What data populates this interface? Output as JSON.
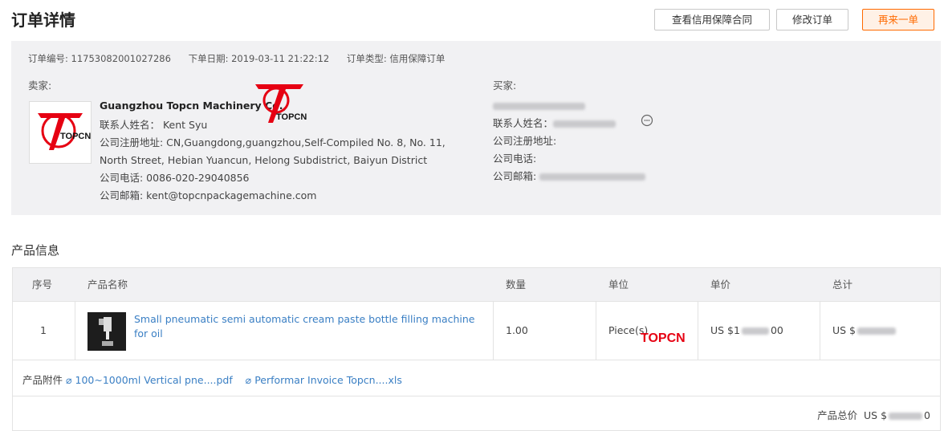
{
  "header": {
    "title": "订单详情",
    "buttons": {
      "view_contract": "查看信用保障合同",
      "modify_order": "修改订单",
      "reorder": "再来一单"
    }
  },
  "order_meta": {
    "order_no": "订单编号: 11753082001027286",
    "order_date": "下单日期: 2019-03-11 21:22:12",
    "order_type": "订单类型: 信用保障订单"
  },
  "seller": {
    "label": "卖家:",
    "logo_text": "TOPCN",
    "name": "Guangzhou Topcn Machinery Co.,",
    "contact": "联系人姓名： Kent Syu",
    "address": "公司注册地址: CN,Guangdong,guangzhou,Self-Compiled No. 8, No. 11, North Street, Hebian Yuancun, Helong Subdistrict, Baiyun District",
    "phone": "公司电话: 0086-020-29040856",
    "email": "公司邮箱: kent@topcnpackagemachine.com"
  },
  "buyer": {
    "label": "买家:",
    "contact_label": "联系人姓名：",
    "address_label": "公司注册地址:",
    "phone_label": "公司电话:",
    "email_label": "公司邮箱:"
  },
  "products": {
    "section_title": "产品信息",
    "columns": [
      "序号",
      "产品名称",
      "数量",
      "单位",
      "单价",
      "总计"
    ],
    "rows": [
      {
        "index": "1",
        "name": "Small pneumatic semi automatic cream paste bottle filling machine for oil",
        "quantity": "1.00",
        "unit": "Piece(s)",
        "unit_price": "US $1",
        "unit_price_tail": "00",
        "total": "US $"
      }
    ],
    "attachments_label": "产品附件",
    "attachments": [
      "100~1000ml Vertical pne....pdf",
      "Performar Invoice Topcn....xls"
    ],
    "total_label": "产品总价",
    "total_value": "US $",
    "total_tail": "0"
  },
  "watermark": "TOPCN",
  "colors": {
    "accent": "#ff6a00",
    "link": "#3a7fc4",
    "panel": "#f1f1f3",
    "logo_red": "#e60012"
  }
}
